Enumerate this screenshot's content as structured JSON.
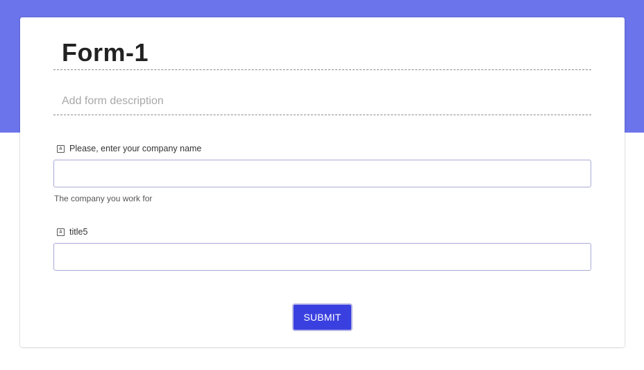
{
  "theme": {
    "banner_color": "#6c74ec",
    "button_color": "#3a40e0"
  },
  "form": {
    "title": "Form-1",
    "description_placeholder": "Add form description",
    "fields": [
      {
        "icon": "text-field-icon",
        "icon_glyph": "A",
        "label": "Please, enter your company name",
        "value": "",
        "help": "The company you work for"
      },
      {
        "icon": "text-field-icon",
        "icon_glyph": "A",
        "label": "title5",
        "value": ""
      }
    ],
    "submit_label": "SUBMIT"
  }
}
